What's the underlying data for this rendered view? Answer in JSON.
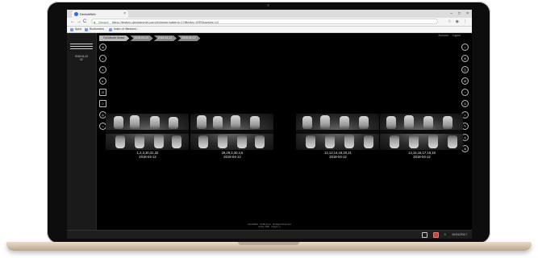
{
  "browser": {
    "tab_title": "DentalWeb",
    "tab_close": "×",
    "window_controls": [
      "–",
      "□",
      "×"
    ],
    "nav": {
      "back": "←",
      "forward": "→",
      "reload": "C"
    },
    "secure_label": "Secure",
    "url": "https://testing.dentiskynet.com/#/viewer/patient=1?filterby=XRR&series=12",
    "bookmarks": [
      {
        "label": "Apps"
      },
      {
        "label": "Bookmarks"
      },
      {
        "label": "Index of /filestore/..."
      }
    ]
  },
  "app": {
    "top_links": [
      "Account",
      "Logout"
    ],
    "breadcrumbs": [
      "Full Mouth Series",
      "2018-04-12",
      "2018-04-12",
      "2018-04-12"
    ],
    "patient": {
      "date": "2018-04-12",
      "id": "02"
    },
    "left_tools": [
      "⊕",
      "◐",
      "◑",
      "▸",
      "⊟",
      "☺",
      "◎",
      "⌂"
    ],
    "right_tools": [
      "i",
      "⊕",
      "◫",
      "⊞",
      "◔",
      "⊙",
      "◐",
      "✎",
      "◎",
      "⊚"
    ],
    "xrays": [
      {
        "teeth": "1,2,3,30,31,32",
        "date": "2018-04-12"
      },
      {
        "teeth": "28,29,3,30,4,5",
        "date": "2018-04-12"
      },
      {
        "teeth": "12,13,14,19,20,21",
        "date": "2018-04-12"
      },
      {
        "teeth": "14,15,16,17,18,19",
        "date": "2018-04-12"
      }
    ],
    "footer_note": [
      "DentalWeb · 2018-04-12 · All Rights Reserved",
      "Study: XRR · Images: 4"
    ],
    "taskbar": {
      "page": "1",
      "datetime": "10/31/2017"
    }
  },
  "colors": {
    "background": "#000000",
    "panel": "#1a1a1a",
    "caption_text": "#e6e6e6",
    "laptop_frame": "#cdbda6"
  }
}
